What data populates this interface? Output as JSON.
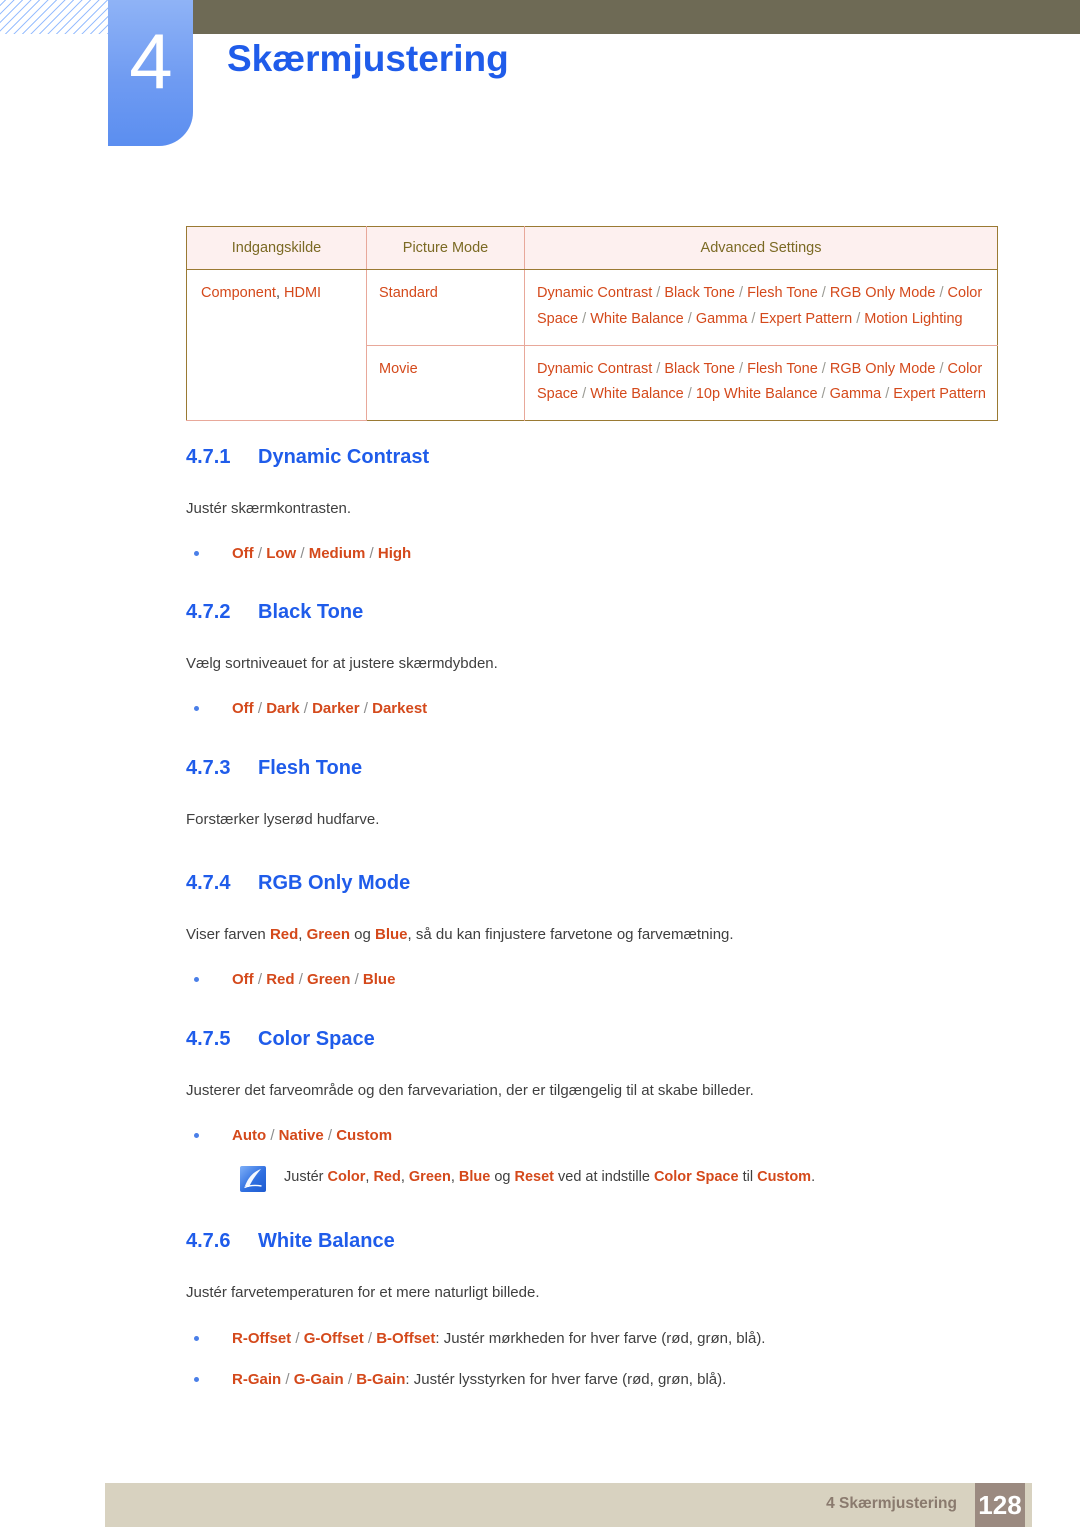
{
  "header": {
    "chapter_number": "4",
    "chapter_title": "Skærmjustering",
    "accent_blue": "#1f5cea",
    "olive_bar_color": "#6e6a55"
  },
  "table": {
    "headers": [
      "Indgangskilde",
      "Picture Mode",
      "Advanced Settings"
    ],
    "rows": [
      {
        "source": "Component, HDMI",
        "source_plain_part": ", HDMI",
        "picture_mode": "Standard",
        "advanced_settings": [
          "Dynamic Contrast",
          "Black Tone",
          "Flesh Tone",
          "RGB Only Mode",
          "Color Space",
          "White Balance",
          "Gamma",
          "Expert Pattern",
          "Motion Lighting"
        ]
      },
      {
        "source": "",
        "picture_mode": "Movie",
        "advanced_settings": [
          "Dynamic Contrast",
          "Black Tone",
          "Flesh Tone",
          "RGB Only Mode",
          "Color Space",
          "White Balance",
          "10p White Balance",
          "Gamma",
          "Expert Pattern"
        ]
      }
    ],
    "header_bg": "#fdf0ef",
    "header_text_color": "#7b6a24",
    "cell_text_color": "#d4491b",
    "outer_border_color": "#9a7a33",
    "inner_border_color": "#e8a89a"
  },
  "sections": [
    {
      "number": "4.7.1",
      "title": "Dynamic Contrast",
      "description": "Justér skærmkontrasten.",
      "options": [
        "Off",
        "Low",
        "Medium",
        "High"
      ]
    },
    {
      "number": "4.7.2",
      "title": "Black Tone",
      "description": "Vælg sortniveauet for at justere skærmdybden.",
      "options": [
        "Off",
        "Dark",
        "Darker",
        "Darkest"
      ]
    },
    {
      "number": "4.7.3",
      "title": "Flesh Tone",
      "description": "Forstærker lyserød hudfarve.",
      "options": []
    },
    {
      "number": "4.7.4",
      "title": "RGB Only Mode",
      "description_parts": [
        {
          "text": "Viser farven ",
          "kw": false
        },
        {
          "text": "Red",
          "kw": true
        },
        {
          "text": ", ",
          "kw": false
        },
        {
          "text": "Green",
          "kw": true
        },
        {
          "text": " og ",
          "kw": false
        },
        {
          "text": "Blue",
          "kw": true
        },
        {
          "text": ", så du kan finjustere farvetone og farvemætning.",
          "kw": false
        }
      ],
      "options": [
        "Off",
        "Red",
        "Green",
        "Blue"
      ]
    },
    {
      "number": "4.7.5",
      "title": "Color Space",
      "description": "Justerer det farveområde og den farvevariation, der er tilgængelig til at skabe billeder.",
      "options": [
        "Auto",
        "Native",
        "Custom"
      ],
      "note": {
        "icon": "note-pen-icon",
        "parts": [
          {
            "text": "Justér ",
            "kw": false
          },
          {
            "text": "Color",
            "kw": true
          },
          {
            "text": ", ",
            "kw": false
          },
          {
            "text": "Red",
            "kw": true
          },
          {
            "text": ", ",
            "kw": false
          },
          {
            "text": "Green",
            "kw": true
          },
          {
            "text": ", ",
            "kw": false
          },
          {
            "text": "Blue",
            "kw": true
          },
          {
            "text": " og ",
            "kw": false
          },
          {
            "text": "Reset",
            "kw": true
          },
          {
            "text": " ved at indstille ",
            "kw": false
          },
          {
            "text": "Color Space",
            "kw": true
          },
          {
            "text": " til ",
            "kw": false
          },
          {
            "text": "Custom",
            "kw": true
          },
          {
            "text": ".",
            "kw": false
          }
        ]
      }
    },
    {
      "number": "4.7.6",
      "title": "White Balance",
      "description": "Justér farvetemperaturen for et mere naturligt billede.",
      "detail_bullets": [
        {
          "keywords": [
            "R-Offset",
            "G-Offset",
            "B-Offset"
          ],
          "tail": ": Justér mørkheden for hver farve (rød, grøn, blå)."
        },
        {
          "keywords": [
            "R-Gain",
            "G-Gain",
            "B-Gain"
          ],
          "tail": ": Justér lysstyrken for hver farve (rød, grøn, blå)."
        }
      ]
    }
  ],
  "footer": {
    "label": "4 Skærmjustering",
    "page_number": "128",
    "bar_color": "#d8d2c0",
    "page_box_color": "#9b8a80"
  }
}
